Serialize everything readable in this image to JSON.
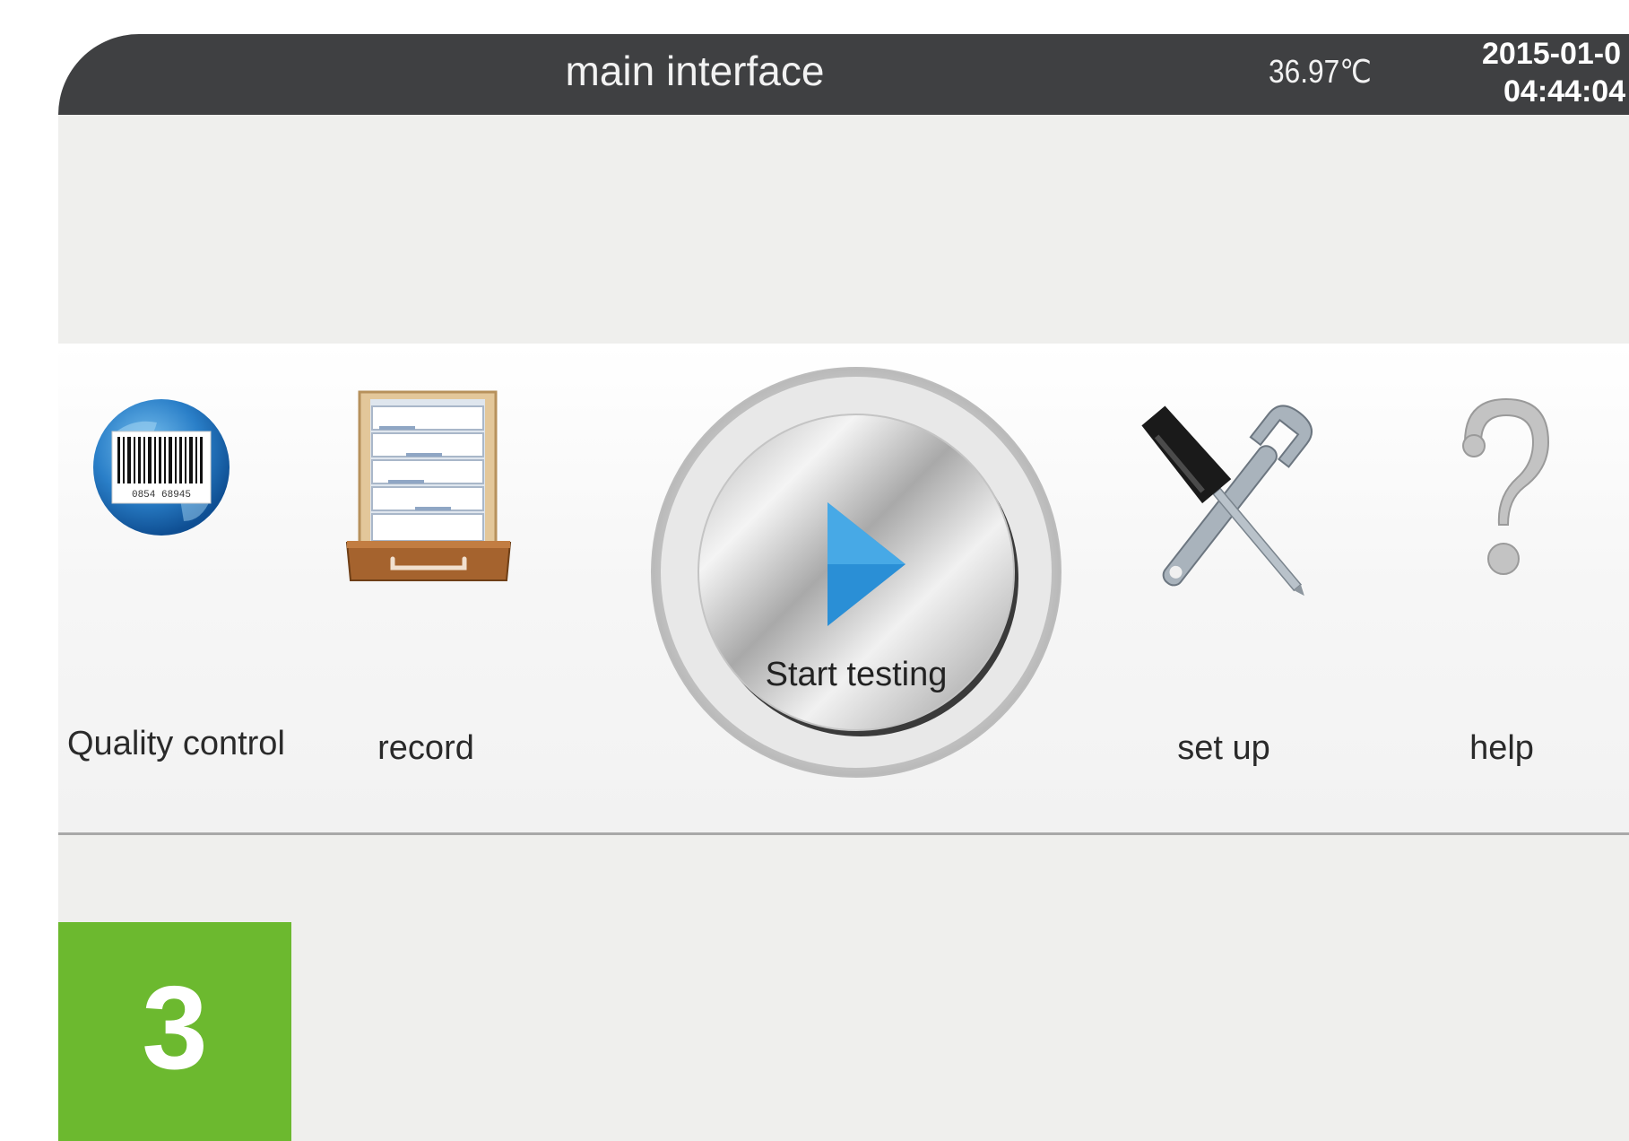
{
  "header": {
    "title": "main interface",
    "temperature": "36.97℃",
    "date": "2015-01-0",
    "time": "04:44:04"
  },
  "menu": {
    "quality_control": {
      "label": "Quality control",
      "icon": "barcode-globe-icon"
    },
    "record": {
      "label": "record",
      "icon": "file-drawer-icon"
    },
    "start_testing": {
      "label": "Start testing",
      "icon": "play-icon"
    },
    "set_up": {
      "label": "set up",
      "icon": "tools-icon"
    },
    "help": {
      "label": "help",
      "icon": "question-mark-icon"
    }
  },
  "barcode_digits": "0854 68945",
  "step_badge": {
    "number": "3",
    "color": "#6cb92f"
  },
  "colors": {
    "titlebar": "#3f4042",
    "background": "#efefed",
    "accent_play": "#2a8fd6"
  }
}
